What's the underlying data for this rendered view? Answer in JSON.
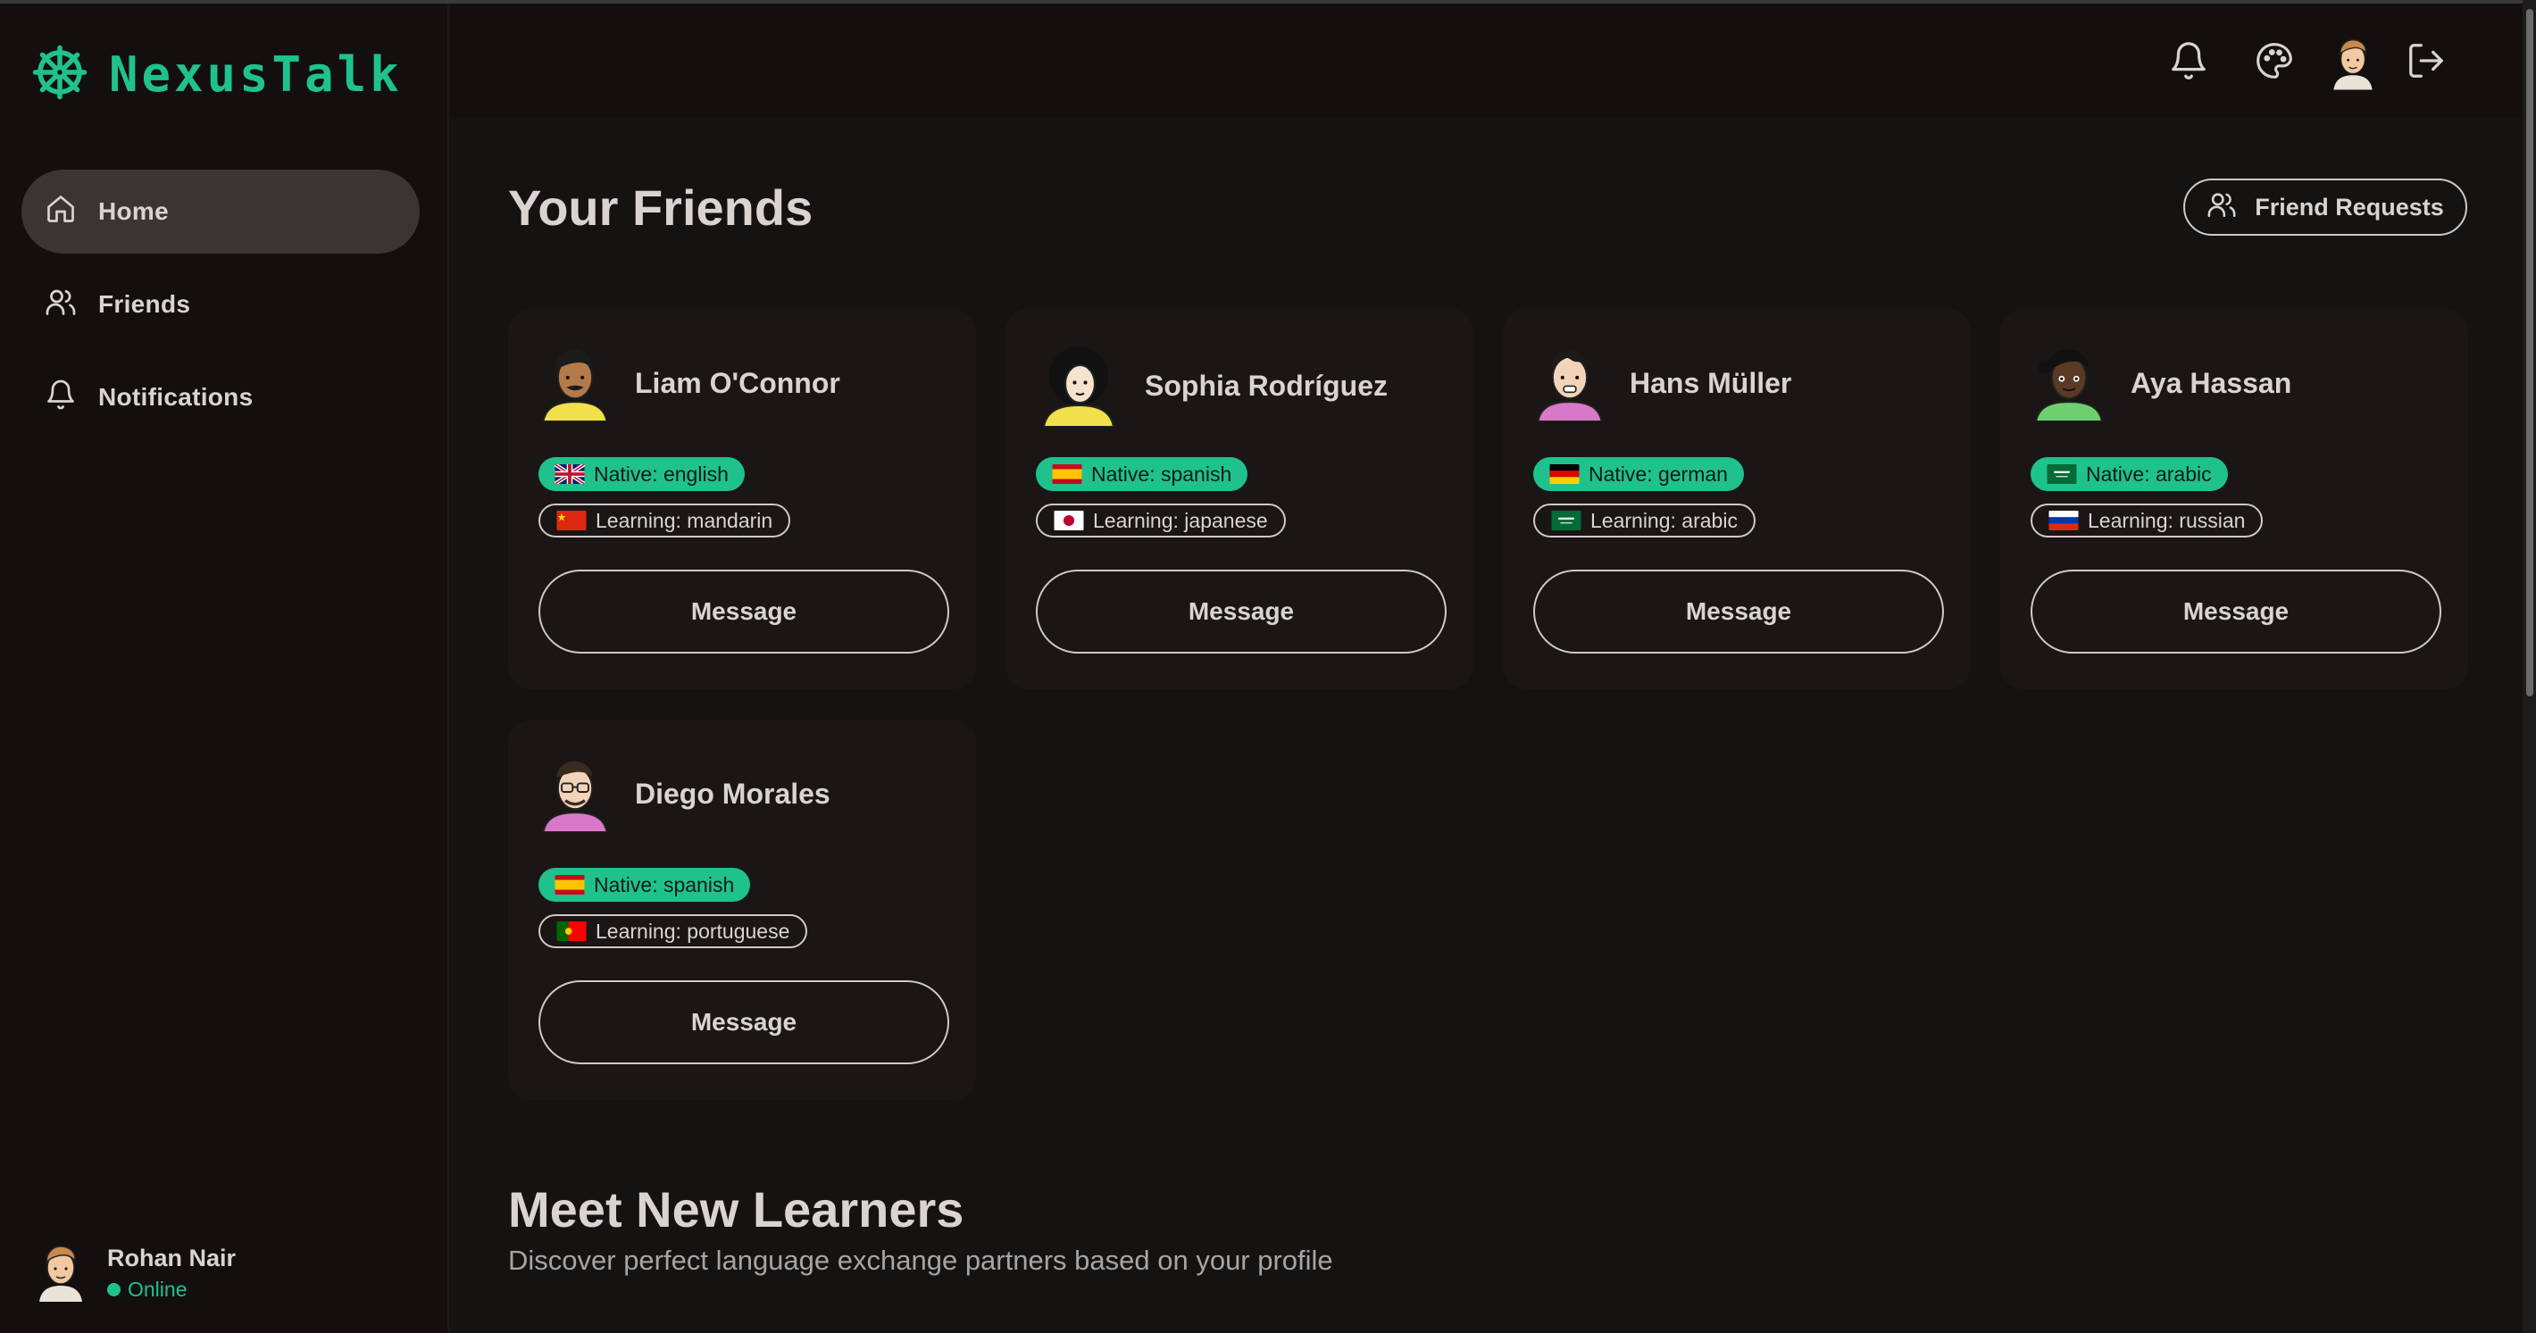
{
  "app": {
    "name": "NexusTalk"
  },
  "colors": {
    "accent": "#1fc28d",
    "background": "#151212",
    "surface": "#1a1616"
  },
  "sidebar": {
    "items": [
      {
        "label": "Home",
        "icon": "home-icon",
        "active": true
      },
      {
        "label": "Friends",
        "icon": "users-icon",
        "active": false
      },
      {
        "label": "Notifications",
        "icon": "bell-icon",
        "active": false
      }
    ],
    "user": {
      "name": "Rohan Nair",
      "status": "Online"
    }
  },
  "header": {
    "icons": [
      "bell-icon",
      "palette-icon",
      "avatar",
      "logout-icon"
    ]
  },
  "main": {
    "title": "Your Friends",
    "friend_requests_label": "Friend Requests",
    "friends": [
      {
        "name": "Liam O'Connor",
        "native": "Native: english",
        "native_flag": "uk-flag",
        "learning": "Learning: mandarin",
        "learning_flag": "china-flag",
        "message_label": "Message"
      },
      {
        "name": "Sophia Rodríguez",
        "native": "Native: spanish",
        "native_flag": "spain-flag",
        "learning": "Learning: japanese",
        "learning_flag": "japan-flag",
        "message_label": "Message"
      },
      {
        "name": "Hans Müller",
        "native": "Native: german",
        "native_flag": "germany-flag",
        "learning": "Learning: arabic",
        "learning_flag": "saudi-flag",
        "message_label": "Message"
      },
      {
        "name": "Aya Hassan",
        "native": "Native: arabic",
        "native_flag": "saudi-flag",
        "learning": "Learning: russian",
        "learning_flag": "russia-flag",
        "message_label": "Message"
      },
      {
        "name": "Diego Morales",
        "native": "Native: spanish",
        "native_flag": "spain-flag",
        "learning": "Learning: portuguese",
        "learning_flag": "portugal-flag",
        "message_label": "Message"
      }
    ],
    "meet_title": "Meet New Learners",
    "meet_subtitle": "Discover perfect language exchange partners based on your profile"
  }
}
